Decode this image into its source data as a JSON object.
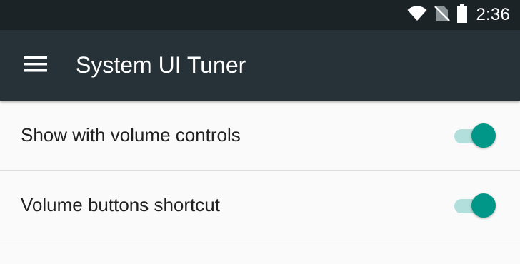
{
  "status_bar": {
    "time": "2:36",
    "icons": [
      "wifi-icon",
      "no-sim-icon",
      "battery-icon"
    ]
  },
  "app_bar": {
    "title": "System UI Tuner",
    "menu_icon": "hamburger-menu-icon"
  },
  "settings": [
    {
      "label": "Show with volume controls",
      "enabled": true
    },
    {
      "label": "Volume buttons shortcut",
      "enabled": true
    }
  ],
  "colors": {
    "status_bar": "#1c2326",
    "app_bar": "#263238",
    "accent": "#009688",
    "accent_track": "#b2dfdb",
    "background": "#fafafa"
  }
}
